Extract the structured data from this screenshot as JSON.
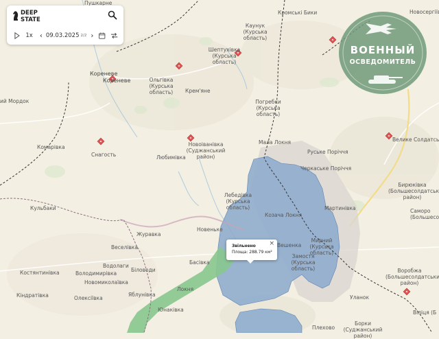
{
  "brand": {
    "line1": "DEEP",
    "line2": "STATE"
  },
  "controls": {
    "speed": "1x",
    "date": "09.03.2025",
    "page": "2/2"
  },
  "popup": {
    "title": "Звільнено",
    "area_label": "Площа: 288.79 км²",
    "close": "×"
  },
  "watermark": {
    "line1": "ВОЕННЫЙ",
    "line2": "ОСВЕДОМИТЕЛЬ"
  },
  "colors": {
    "liberated": "#8aa9cc",
    "grey_zone": "#d9d6d0",
    "ukraine": "#88c78f",
    "marker": "#e05555",
    "background": "#f3efe2"
  },
  "labels": {
    "pushkarne": "Пушкарне",
    "kromski_byky": "Кромські Бики",
    "novoserhiivka": "Новосергіївка",
    "kaunuk": "Каунук (Курська область)",
    "sheptukhivka": "Шептухівка (Курська область)",
    "korenevo_1": "Кореневе",
    "korenevo_2": "Кореневе",
    "olhivka": "Ольгівка (Курська область)",
    "kremiane": "Крем'яне",
    "pohrebky": "Погребки (Курська область)",
    "mordok": "ий Мордок",
    "komarivka": "Комарівка",
    "snahost": "Снагость",
    "novoivanivka": "Новоіванівка (Суджанський район)",
    "liubymivka": "Любимівка",
    "mala_lokna": "Мала Локня",
    "ruske_porichne": "Руське Поріччя",
    "cherkaske_porichne": "Черкаське Поріччя",
    "velyke_soldatske": "Велике Солдатське",
    "biriukivka": "Бирюківка (Большесолдатський район)",
    "samorodkove": "Саморо (Большесолд",
    "lebedivka": "Лебедівка (Курська область)",
    "martynivka": "Мартинівка",
    "kozacha_lokna": "Козача Локня",
    "kulbaky": "Кульбаки",
    "zhuravka": "Журавка",
    "novenke": "Новеньке",
    "veselivka": "Веселівка",
    "mirnyi": "Мирний (Курська область)",
    "bieshenka": "Вешенка",
    "zamostia": "Замостя (Курська область)",
    "kostiantynivka": "Костянтинівка",
    "vodolahy": "Водолаги",
    "volodymyrivka": "Володимирівка",
    "bilovody": "Біловоди",
    "basivka": "Басівка",
    "novomykolaivka": "Новомиколаївка",
    "vorobzha": "Воробжа (Большесолдатський район)",
    "kindrativka": "Кіндратівка",
    "oleksiivka": "Олексіївка",
    "yablunivka": "Яблунівка",
    "lokhnia": "Локня",
    "ulanok": "Уланок",
    "yunakivka": "Юнаківка",
    "plekhovo": "Плехово",
    "borky": "Борки (Суджанський район)",
    "bilytsia": "Віліця (Б"
  }
}
